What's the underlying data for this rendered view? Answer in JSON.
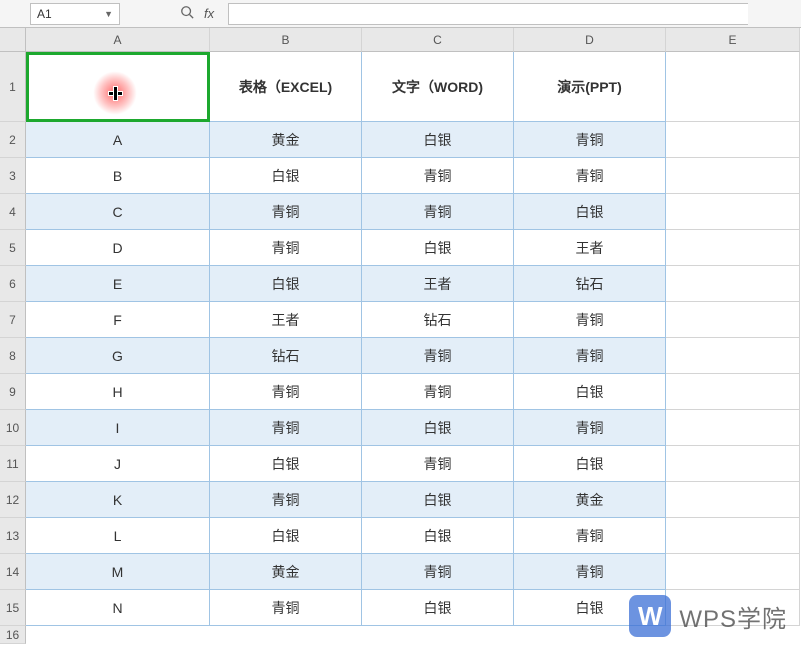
{
  "nameBox": "A1",
  "fxLabel": "fx",
  "formulaValue": "",
  "columns": [
    "A",
    "B",
    "C",
    "D",
    "E"
  ],
  "rowNumbers": [
    "1",
    "2",
    "3",
    "4",
    "5",
    "6",
    "7",
    "8",
    "9",
    "10",
    "11",
    "12",
    "13",
    "14",
    "15",
    "16"
  ],
  "headerRow": {
    "A": "",
    "B": "表格（EXCEL)",
    "C": "文字（WORD)",
    "D": "演示(PPT)"
  },
  "rows": [
    {
      "letter": "A",
      "B": "黄金",
      "C": "白银",
      "D": "青铜",
      "hl": true
    },
    {
      "letter": "B",
      "B": "白银",
      "C": "青铜",
      "D": "青铜",
      "hl": false
    },
    {
      "letter": "C",
      "B": "青铜",
      "C": "青铜",
      "D": "白银",
      "hl": true
    },
    {
      "letter": "D",
      "B": "青铜",
      "C": "白银",
      "D": "王者",
      "hl": false
    },
    {
      "letter": "E",
      "B": "白银",
      "C": "王者",
      "D": "钻石",
      "hl": true
    },
    {
      "letter": "F",
      "B": "王者",
      "C": "钻石",
      "D": "青铜",
      "hl": false
    },
    {
      "letter": "G",
      "B": "钻石",
      "C": "青铜",
      "D": "青铜",
      "hl": true
    },
    {
      "letter": "H",
      "B": "青铜",
      "C": "青铜",
      "D": "白银",
      "hl": false
    },
    {
      "letter": "I",
      "B": "青铜",
      "C": "白银",
      "D": "青铜",
      "hl": true
    },
    {
      "letter": "J",
      "B": "白银",
      "C": "青铜",
      "D": "白银",
      "hl": false
    },
    {
      "letter": "K",
      "B": "青铜",
      "C": "白银",
      "D": "黄金",
      "hl": true
    },
    {
      "letter": "L",
      "B": "白银",
      "C": "白银",
      "D": "青铜",
      "hl": false
    },
    {
      "letter": "M",
      "B": "黄金",
      "C": "青铜",
      "D": "青铜",
      "hl": true
    },
    {
      "letter": "N",
      "B": "青铜",
      "C": "白银",
      "D": "白银",
      "hl": false
    }
  ],
  "watermark": {
    "logo": "W",
    "text": "WPS学院"
  }
}
